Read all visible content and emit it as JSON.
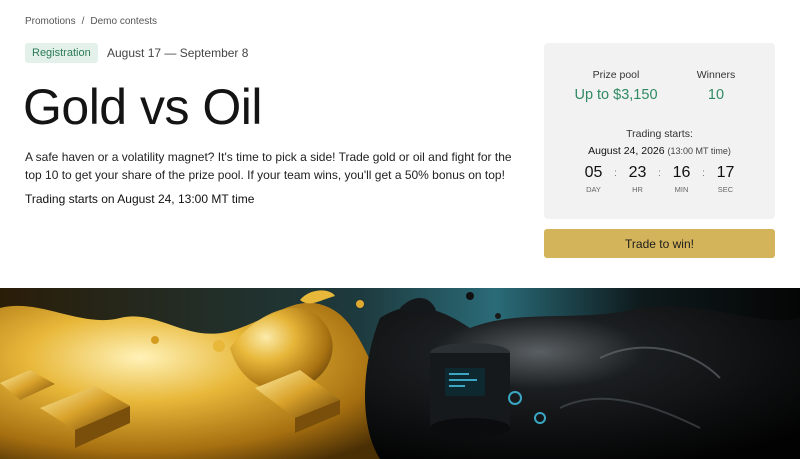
{
  "breadcrumb": {
    "items": [
      "Promotions",
      "Demo contests"
    ],
    "separator": "/"
  },
  "contest": {
    "status_badge": "Registration",
    "dates": "August 17 — September 8",
    "title": "Gold vs Oil",
    "description": "A safe haven or a volatility magnet? It's time to pick a side! Trade gold or oil and fight for the top 10 to get your share of the prize pool. If your team wins, you'll get a 50% bonus on top!",
    "trading_note": "Trading starts on August 24, 13:00 MT time"
  },
  "panel": {
    "prize_pool_label": "Prize pool",
    "prize_pool_value": "Up to $3,150",
    "winners_label": "Winners",
    "winners_value": "10",
    "trading_starts_label": "Trading starts:",
    "trading_starts_date": "August 24, 2026",
    "trading_starts_tz": "(13:00 MT time)",
    "countdown": {
      "days": "05",
      "days_label": "DAY",
      "hours": "23",
      "hours_label": "HR",
      "minutes": "16",
      "minutes_label": "MIN",
      "seconds": "17",
      "seconds_label": "SEC",
      "separator": ":"
    },
    "cta_label": "Trade to win!"
  },
  "colors": {
    "badge_bg": "#e3f1ea",
    "badge_text": "#2a7a55",
    "accent_green": "#2f8a63",
    "cta_gold": "#d4b45a",
    "panel_bg": "#f2f2f2"
  },
  "banner": {
    "image": "gold-vs-oil-splash"
  }
}
